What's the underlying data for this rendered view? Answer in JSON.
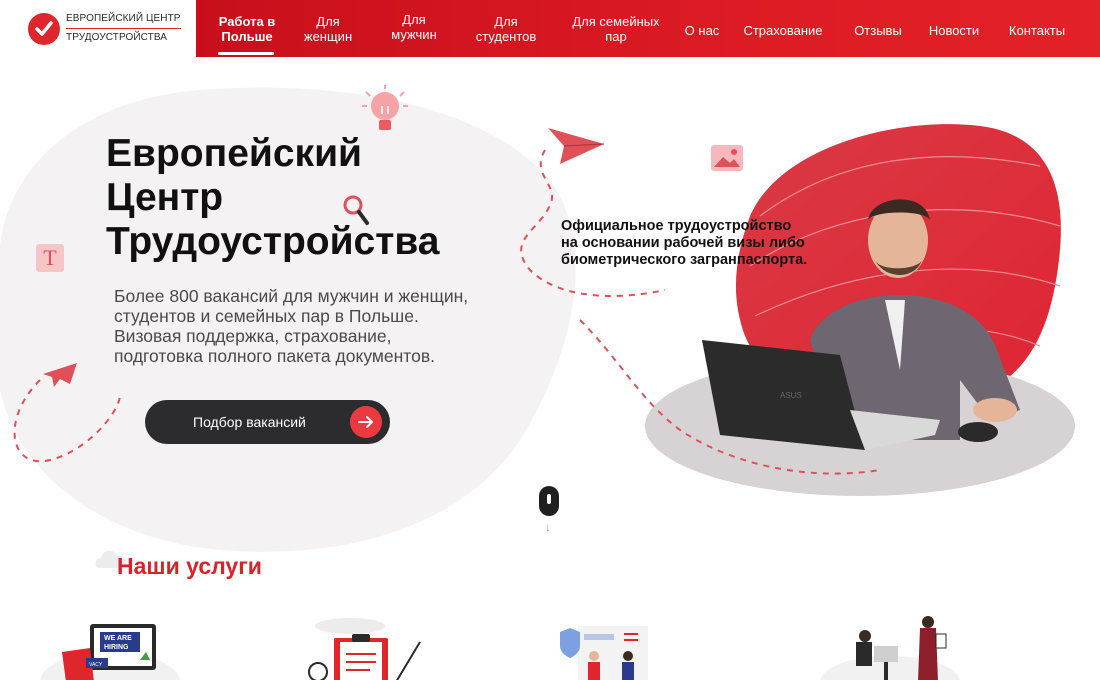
{
  "logo": {
    "line1": "ЕВРОПЕЙСКИЙ ЦЕНТР",
    "line2": "ТРУДОУСТРОЙСТВА"
  },
  "nav": {
    "items": [
      {
        "label": "Работа в\nПольше",
        "active": true
      },
      {
        "label": "Для\nженщин"
      },
      {
        "label": "Для\nмужчин"
      },
      {
        "label": "Для\nстудентов"
      },
      {
        "label": "Для семейных\nпар"
      },
      {
        "label": "О нас"
      },
      {
        "label": "Страхование"
      },
      {
        "label": "Отзывы"
      },
      {
        "label": "Новости"
      },
      {
        "label": "Контакты"
      }
    ]
  },
  "hero": {
    "title_l1": "Европейский",
    "title_l2": "Центр",
    "title_l3": "Трудоустройства",
    "desc_l1": "Более 800 вакансий для мужчин и женщин,",
    "desc_l2": "студентов и семейных пар в Польше.",
    "desc_l3": "Визовая поддержка, страхование,",
    "desc_l4": "подготовка полного пакета документов.",
    "cta_label": "Подбор вакансий",
    "note_l1": "Официальное трудоустройство",
    "note_l2": "на основании рабочей визы либо",
    "note_l3": "биометрического загранпаспорта."
  },
  "services": {
    "title": "Наши услуги",
    "hiring_sign_l1": "WE ARE",
    "hiring_sign_l2": "HIRING",
    "vacancy_tag": "VACY"
  },
  "colors": {
    "brand_red": "#e0262d",
    "dark": "#2c2b2e",
    "blob_pink": "#f6eff0"
  },
  "icons": [
    "check-icon",
    "arrow-right-icon",
    "lightbulb-icon",
    "magnifier-icon",
    "text-t-icon",
    "paper-plane-icon",
    "image-icon",
    "scroll-mouse-icon"
  ]
}
